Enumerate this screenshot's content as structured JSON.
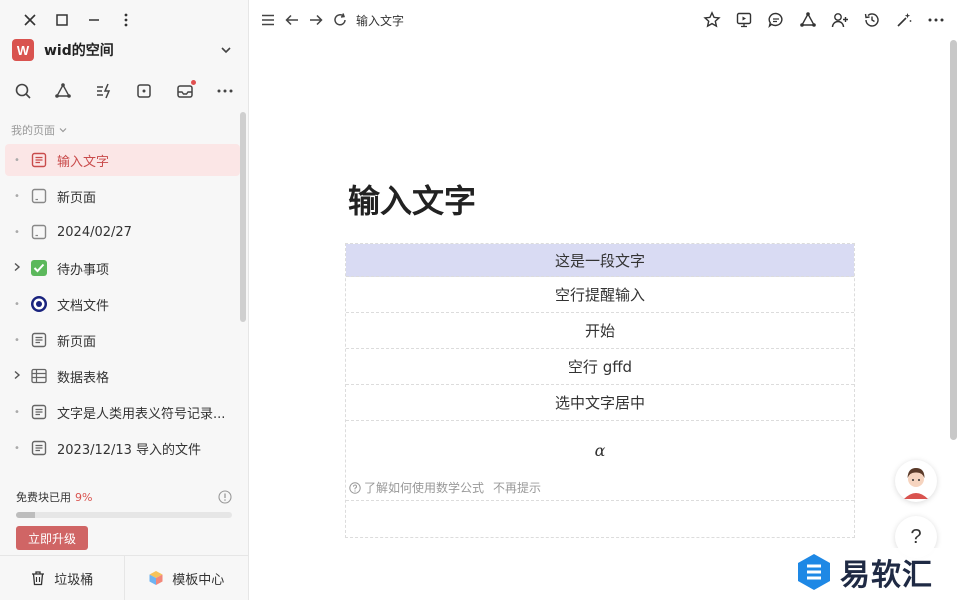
{
  "sidebar": {
    "space": {
      "avatar_letter": "W",
      "name": "wid的空间"
    },
    "section_label": "我的页面",
    "items": [
      {
        "label": "输入文字",
        "active": true
      },
      {
        "label": "新页面"
      },
      {
        "label": "2024/02/27"
      },
      {
        "label": "待办事项"
      },
      {
        "label": "文档文件"
      },
      {
        "label": "新页面"
      },
      {
        "label": "数据表格"
      },
      {
        "label": "文字是人类用表义符号记录..."
      },
      {
        "label": "2023/12/13 导入的文件"
      }
    ],
    "quota": {
      "label": "免费块已用",
      "percent_label": "9%",
      "used_fraction": 0.09,
      "upgrade_label": "立即升级"
    },
    "footer": {
      "trash_label": "垃圾桶",
      "templates_label": "模板中心"
    }
  },
  "topbar": {
    "doc_title": "输入文字"
  },
  "document": {
    "title": "输入文字",
    "rows": [
      "这是一段文字",
      "空行提醒输入",
      "开始",
      "空行 gffd",
      "选中文字居中"
    ],
    "math": {
      "symbol": "α",
      "hint": "了解如何使用数学公式",
      "dismiss": "不再提示"
    }
  },
  "float": {
    "help_label": "?"
  },
  "watermark": {
    "text": "易软汇"
  },
  "colors": {
    "accent": "#d9534f",
    "highlight": "#d9dbf3",
    "active_bg": "#fbe6e6"
  }
}
